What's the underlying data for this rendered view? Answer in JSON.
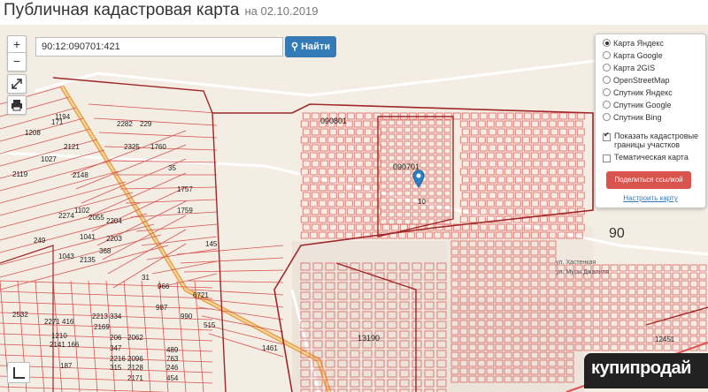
{
  "header": {
    "title": "Публичная кадастровая карта",
    "date": "на 02.10.2019"
  },
  "controls": {
    "zoom_in": "+",
    "zoom_out": "−"
  },
  "search": {
    "value": "90:12:090701:421",
    "button_label": "Найти"
  },
  "layers": {
    "options": [
      {
        "label": "Карта Яндекс",
        "selected": true
      },
      {
        "label": "Карта Google",
        "selected": false
      },
      {
        "label": "Карта 2GIS",
        "selected": false
      },
      {
        "label": "OpenStreetMap",
        "selected": false
      },
      {
        "label": "Спутник Яндекс",
        "selected": false
      },
      {
        "label": "Спутник Google",
        "selected": false
      },
      {
        "label": "Спутник Bing",
        "selected": false
      }
    ],
    "show_boundaries": {
      "label": "Показать кадастровые границы участков",
      "checked": true
    },
    "thematic": {
      "label": "Тематическая карта",
      "checked": false
    },
    "share_label": "Поделиться ссылкой",
    "fit_label": "Настроить карту"
  },
  "map_labels": {
    "big_90": "90",
    "q_090801": "090801",
    "q_090701": "090701",
    "q_13190": "13190",
    "street_1": "ул. Хастенкая",
    "street_2": "ул. Мусы Джалиля",
    "parcels": [
      "1208",
      "2121",
      "2119",
      "1027",
      "2148",
      "1194",
      "2282",
      "229",
      "2325",
      "1760",
      "35",
      "1757",
      "1759",
      "145",
      "2274",
      "1102",
      "2055",
      "1041",
      "2204",
      "2203",
      "249",
      "2135",
      "368",
      "1043",
      "31",
      "966",
      "6721",
      "987",
      "990",
      "515",
      "2532",
      "2271",
      "416",
      "2213",
      "334",
      "2169",
      "1210",
      "206",
      "2062",
      "2141",
      "166",
      "347",
      "2216",
      "2096",
      "187",
      "315",
      "2128",
      "2171",
      "246",
      "489",
      "763",
      "454",
      "12451",
      "10",
      "171",
      "1461"
    ]
  },
  "watermark": {
    "text": "купипродай"
  },
  "colors": {
    "parcel_line": "#d9534f",
    "highway": "#e8a24a",
    "map_bg": "#f3ede4",
    "accent": "#337ab7"
  }
}
